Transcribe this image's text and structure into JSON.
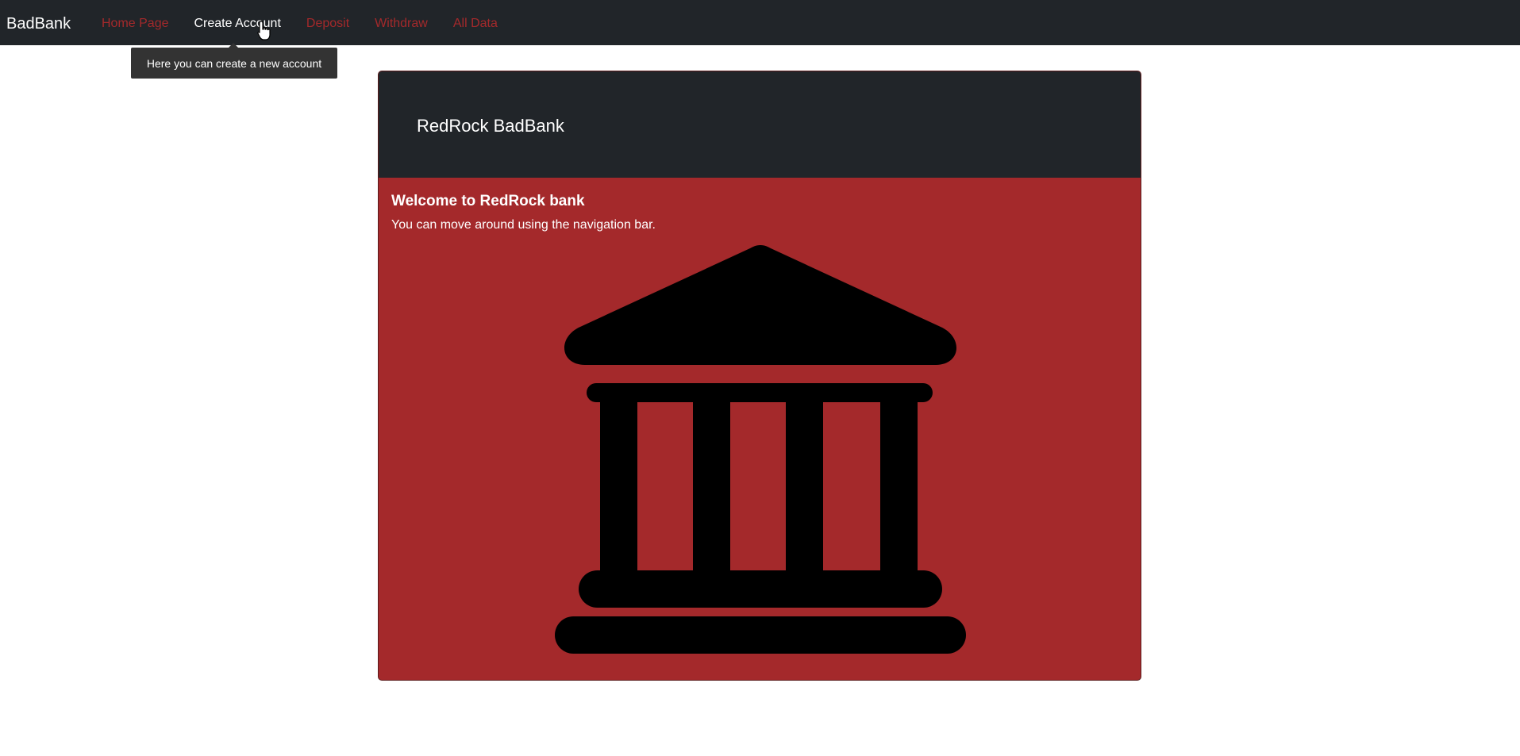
{
  "navbar": {
    "brand": "BadBank",
    "links": [
      {
        "label": "Home Page",
        "active": false
      },
      {
        "label": "Create Account",
        "active": true
      },
      {
        "label": "Deposit",
        "active": false
      },
      {
        "label": "Withdraw",
        "active": false
      },
      {
        "label": "All Data",
        "active": false
      }
    ]
  },
  "tooltip": {
    "text": "Here you can create a new account"
  },
  "card": {
    "header": "RedRock BadBank",
    "title": "Welcome to RedRock bank",
    "text": "You can move around using the navigation bar.",
    "icon": "bank-icon"
  },
  "colors": {
    "navbar_bg": "#212529",
    "accent_red": "#a4292b",
    "link_inactive": "#a4292b",
    "link_active": "#ffffff",
    "tooltip_bg": "#333333"
  }
}
